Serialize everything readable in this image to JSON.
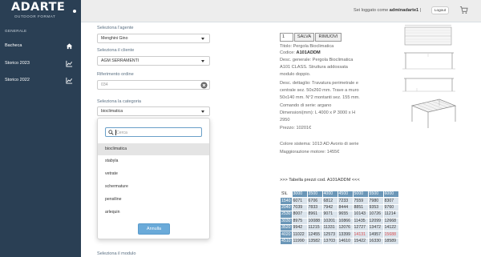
{
  "brand": {
    "name": "ADARTE",
    "tagline": "OUTDOOR FORMAT"
  },
  "sidebar": {
    "heading": "GENERALE",
    "items": [
      {
        "label": "Bacheca",
        "icon": "home-icon"
      },
      {
        "label": "Storico 2023",
        "icon": "chart-icon"
      },
      {
        "label": "Storico 2022",
        "icon": "chart-icon"
      }
    ]
  },
  "header": {
    "welcome_prefix": "Sei loggato come",
    "username": "adminadarte1",
    "separator": "|",
    "logout_label": "Logout",
    "cart_icon": "cart-icon"
  },
  "form": {
    "agent": {
      "label": "Seleziona l'agente",
      "value": "Menghini Gino"
    },
    "client": {
      "label": "Seleziona il cliente",
      "value": "AGM SERRAMENTI"
    },
    "order_ref": {
      "label": "Riferimento ordine",
      "value": "034"
    },
    "category": {
      "label": "Seleziona la categoria",
      "value": "bioclimatica"
    },
    "module": {
      "label": "Seleziona il modulo"
    }
  },
  "dropdown": {
    "search_placeholder": "Cerca",
    "search_value": "",
    "options": [
      "bioclimatica",
      "stabyla",
      "vetrate",
      "schermature",
      "pensiline",
      "arlequin"
    ],
    "selected_index": 0,
    "cancel_label": "Annulla"
  },
  "product": {
    "quantity": "1",
    "save_label": "SALVA",
    "remove_label": "RIMUOVI",
    "lines": [
      "Titolo: Pergola Bioclimatica",
      "Codice: A101ADDM",
      "Desc. generale: Pergola Bioclimatica",
      "A101 CLASS. Struttura addossata",
      "modulo doppio.",
      "Desc. dettaglio: Travatura perimetrale e",
      "centrale sez. 50x260 mm. Trave a muro",
      "50x140 mm. N°2 montanti sez. 155 mm.",
      "Comando di serie: argano",
      "Dimensioni(mm): L 4000 x P 3000 x H",
      "2950",
      "Prezzo: 10201€",
      "Colore sistema: 1013 AD Avorio di serie",
      "Maggiorazione motore: 1455€"
    ],
    "code_label": "Codice:",
    "code_value": "A101ADDM"
  },
  "price_table": {
    "title": ">>> Tabella prezzi cod. A101ADDM <<<",
    "corner": "S\\L",
    "columns": [
      "3000",
      "3500",
      "4000",
      "4500",
      "5000",
      "5500",
      "6000"
    ],
    "rows": [
      {
        "head": "1540",
        "cells": [
          "6071",
          "6706",
          "6812",
          "7233",
          "7559",
          "7980",
          "8307"
        ]
      },
      {
        "head": "2040",
        "cells": [
          "7039",
          "7833",
          "7942",
          "8444",
          "8851",
          "9353",
          "9760"
        ]
      },
      {
        "head": "2530",
        "cells": [
          "8007",
          "8961",
          "9071",
          "9655",
          "10143",
          "10726",
          "11214"
        ]
      },
      {
        "head": "3030",
        "cells": [
          "8975",
          "10088",
          "10201",
          "10866",
          "11435",
          "12099",
          "12668"
        ]
      },
      {
        "head": "3520",
        "cells": [
          "9942",
          "11215",
          "11331",
          "12076",
          "12727",
          "13472",
          "14122"
        ]
      },
      {
        "head": "4020",
        "cells": [
          "11022",
          "12455",
          "12573",
          "13399",
          "14131",
          "14957",
          "15688"
        ]
      },
      {
        "head": "4510",
        "cells": [
          "11990",
          "13582",
          "13703",
          "14610",
          "15422",
          "16330",
          "18589"
        ]
      }
    ],
    "highlight_color": "#e05050"
  },
  "colors": {
    "sidebar_bg": "#2a3f54",
    "accent_blue": "#6aaad9",
    "table_header": "#6b97b8",
    "table_cell": "#dbe4ec"
  }
}
